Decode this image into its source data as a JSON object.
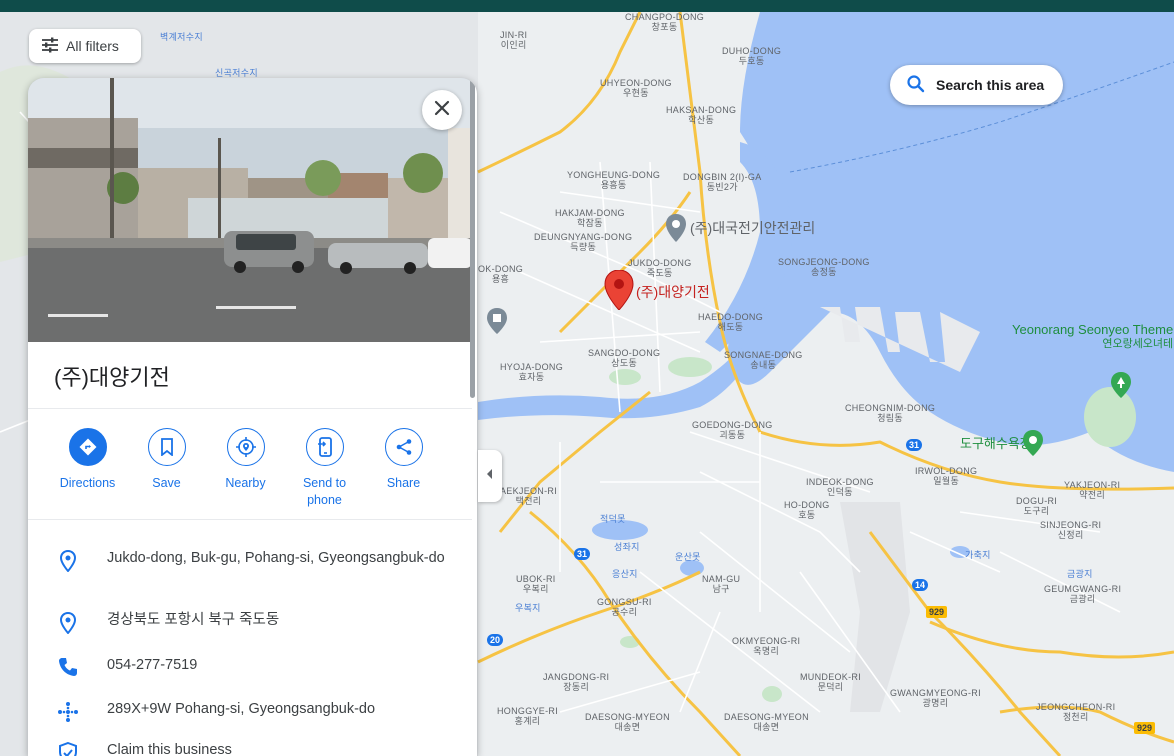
{
  "colors": {
    "accent": "#1a73e8",
    "water": "#9fc1f6",
    "park": "#c8e6c9",
    "marker": "#ea4335"
  },
  "filters": {
    "label": "All filters",
    "icon": "tune-icon"
  },
  "search_area": {
    "label": "Search this area",
    "icon": "search-icon"
  },
  "place": {
    "name": "(주)대양기전",
    "actions": [
      {
        "label": "Directions",
        "icon": "directions-icon"
      },
      {
        "label": "Save",
        "icon": "bookmark-icon"
      },
      {
        "label": "Nearby",
        "icon": "nearby-icon"
      },
      {
        "label": "Send to phone",
        "icon": "send-to-phone-icon"
      },
      {
        "label": "Share",
        "icon": "share-icon"
      }
    ],
    "details": [
      {
        "icon": "location-pin-icon",
        "text": "Jukdo-dong, Buk-gu, Pohang-si, Gyeongsangbuk-do"
      },
      {
        "icon": "location-pin-icon",
        "text": "경상북도 포항시 북구 죽도동"
      },
      {
        "icon": "phone-icon",
        "text": "054-277-7519"
      },
      {
        "icon": "plus-code-icon",
        "text": "289X+9W Pohang-si, Gyeongsangbuk-do"
      },
      {
        "icon": "verified-shield-icon",
        "text": "Claim this business"
      }
    ]
  },
  "map": {
    "selected_marker_label": "(주)대양기전",
    "other_marker_label": "(주)대국전기안전관리",
    "park_label": "Yeonorang Seonyeo Theme Park",
    "park_label_ko": "연오랑세오녀테마공원",
    "beach_label": "도구해수욕장",
    "labels": [
      {
        "en": "CHANGPO-DONG",
        "ko": "창포동"
      },
      {
        "en": "DUHO-DONG",
        "ko": "두호동"
      },
      {
        "en": "UHYEON-DONG",
        "ko": "우현동"
      },
      {
        "en": "HAKSAN-DONG",
        "ko": "학산동"
      },
      {
        "en": "YONGHEUNG-DONG",
        "ko": "용흥동"
      },
      {
        "en": "DONGBIN 2(I)-GA",
        "ko": "동빈2가"
      },
      {
        "en": "HAKJAM-DONG",
        "ko": "학잠동"
      },
      {
        "en": "DEUNGNYANG-DONG",
        "ko": "득량동"
      },
      {
        "en": "JUKDO-DONG",
        "ko": "죽도동"
      },
      {
        "en": "SONGJEONG-DONG",
        "ko": "송정동"
      },
      {
        "en": "HAEDO-DONG",
        "ko": "해도동"
      },
      {
        "en": "SANGDO-DONG",
        "ko": "상도동"
      },
      {
        "en": "SONGNAE-DONG",
        "ko": "송내동"
      },
      {
        "en": "HYOJA-DONG",
        "ko": "효자동"
      },
      {
        "en": "CHEONGNIM-DONG",
        "ko": "청림동"
      },
      {
        "en": "GOEDONG-DONG",
        "ko": "괴동동"
      },
      {
        "en": "IRWOL-DONG",
        "ko": "일월동"
      },
      {
        "en": "INDEOK-DONG",
        "ko": "인덕동"
      },
      {
        "en": "YAKJEON-RI",
        "ko": "약전리"
      },
      {
        "en": "DOGU-RI",
        "ko": "도구리"
      },
      {
        "en": "HO-DONG",
        "ko": "호동"
      },
      {
        "en": "SINJEONG-RI",
        "ko": "신정리"
      },
      {
        "en": "NAM-GU",
        "ko": "남구"
      },
      {
        "en": "GEUMGWANG-RI",
        "ko": "금광리"
      },
      {
        "en": "UBOK-RI",
        "ko": "우복리"
      },
      {
        "en": "GONGSU-RI",
        "ko": "공수리"
      },
      {
        "en": "OKMYEONG-RI",
        "ko": "옥명리"
      },
      {
        "en": "JANGDONG-RI",
        "ko": "장동리"
      },
      {
        "en": "MUNDEOK-RI",
        "ko": "문덕리"
      },
      {
        "en": "GWANGMYEONG-RI",
        "ko": "광명리"
      },
      {
        "en": "JEONGCHEON-RI",
        "ko": "정천리"
      },
      {
        "en": "HONGGYE-RI",
        "ko": "홍계리"
      },
      {
        "en": "DAESONG-MYEON",
        "ko": "대송면"
      },
      {
        "en": "DAESONG-MYEON",
        "ko": "대송면"
      },
      {
        "en": "AEKJEON-RI",
        "ko": "택전리"
      },
      {
        "en": "OK-DONG",
        "ko": "용흥"
      },
      {
        "en": "JIN-RI",
        "ko": "이인리"
      }
    ],
    "misc_labels": [
      "벽계저수지",
      "신곡저수지",
      "가축지",
      "우복지",
      "성좌지",
      "운산못",
      "적덕못",
      "응산지",
      "금광지"
    ],
    "road_numbers": [
      "31",
      "31",
      "14",
      "20",
      "929",
      "929"
    ]
  }
}
